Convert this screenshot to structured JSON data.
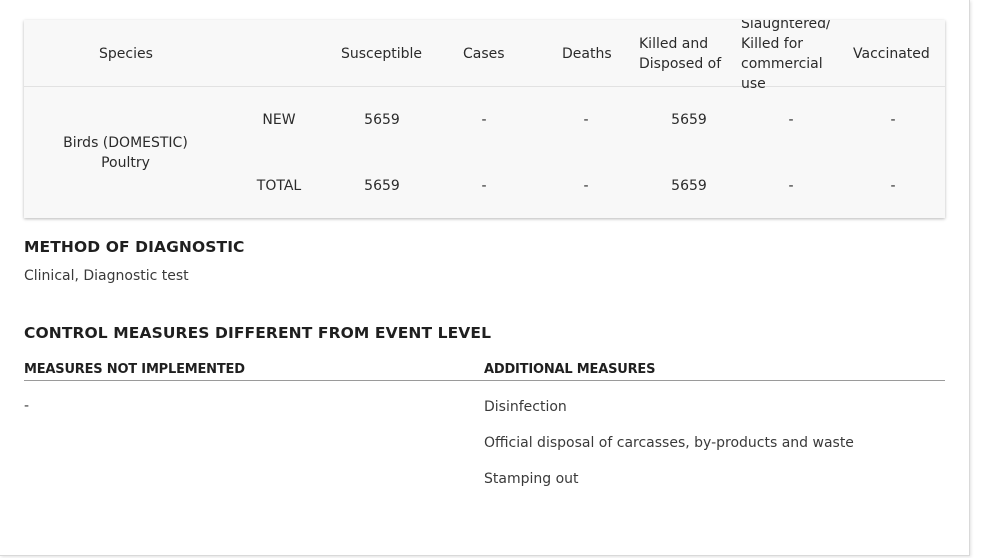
{
  "table": {
    "headers": {
      "species": "Species",
      "susceptible": "Susceptible",
      "cases": "Cases",
      "deaths": "Deaths",
      "killed_line1": "Killed and",
      "killed_line2": "Disposed of",
      "slaughtered_line1": "Slaughtered/",
      "slaughtered_line2": "Killed for",
      "slaughtered_line3": "commercial",
      "slaughtered_line4": "use",
      "vaccinated": "Vaccinated"
    },
    "species_line1": "Birds (DOMESTIC)",
    "species_line2": "Poultry",
    "rows": [
      {
        "label": "NEW",
        "susceptible": "5659",
        "cases": "-",
        "deaths": "-",
        "killed": "5659",
        "slaughtered": "-",
        "vaccinated": "-"
      },
      {
        "label": "TOTAL",
        "susceptible": "5659",
        "cases": "-",
        "deaths": "-",
        "killed": "5659",
        "slaughtered": "-",
        "vaccinated": "-"
      }
    ]
  },
  "diagnostic": {
    "title": "METHOD OF DIAGNOSTIC",
    "value": "Clinical, Diagnostic test"
  },
  "control": {
    "title": "CONTROL MEASURES DIFFERENT FROM EVENT LEVEL",
    "not_implemented_header": "MEASURES NOT IMPLEMENTED",
    "not_implemented_value": "-",
    "additional_header": "ADDITIONAL MEASURES",
    "additional_items": [
      "Disinfection",
      "Official disposal of carcasses, by-products and waste",
      "Stamping out"
    ]
  }
}
